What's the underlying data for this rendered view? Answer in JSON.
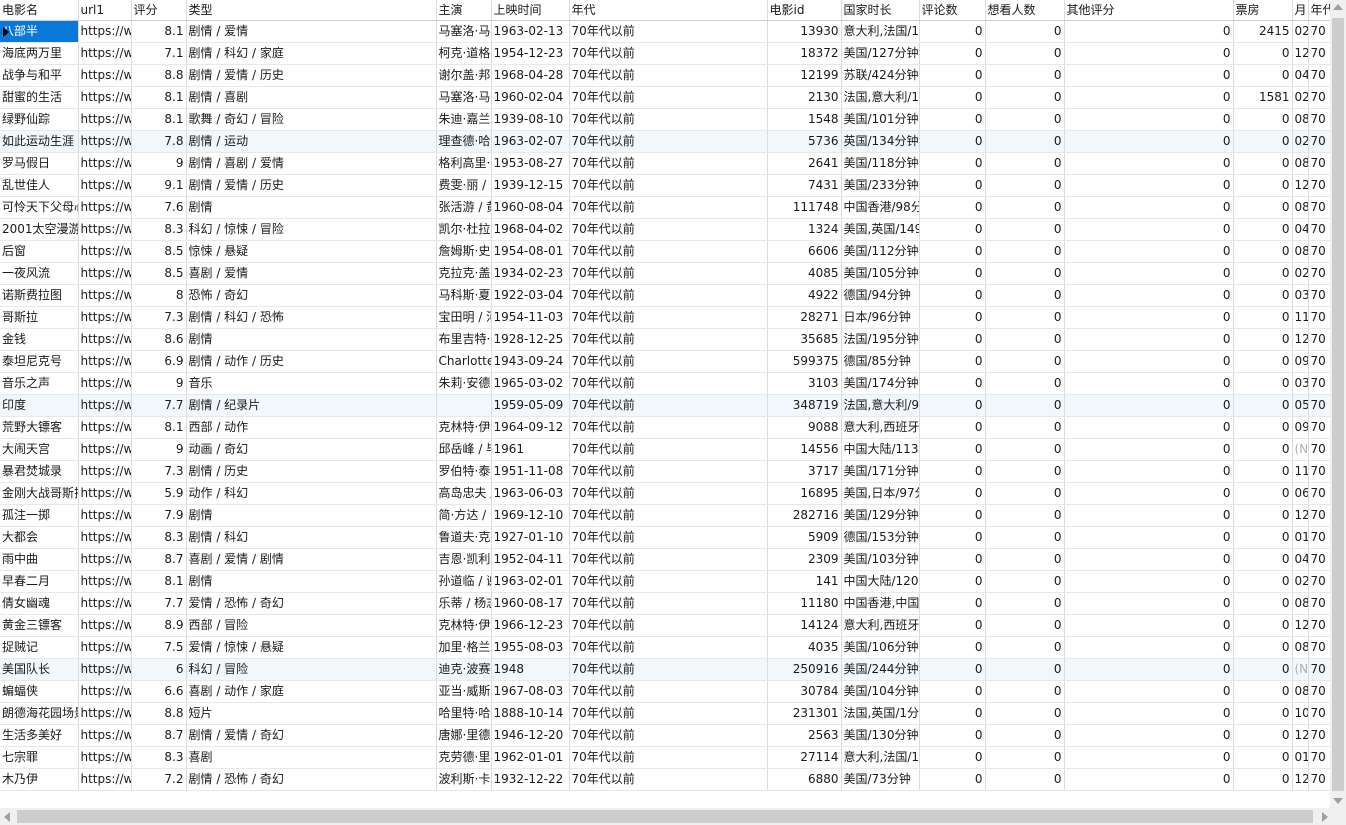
{
  "columns": [
    "电影名",
    "url1",
    "评分",
    "类型",
    "主演",
    "上映时间",
    "年代",
    "电影id",
    "国家时长",
    "评论数",
    "想看人数",
    "其他评分",
    "票房",
    "月",
    "年代"
  ],
  "rows": [
    [
      "八部半",
      "https://w",
      "8.1",
      "剧情 / 爱情",
      "马塞洛·马",
      "1963-02-13",
      "70年代以前",
      "13930",
      "意大利,法国/1",
      "0",
      "0",
      "0",
      "2415",
      "02",
      "70"
    ],
    [
      "海底两万里",
      "https://w",
      "7.1",
      "剧情 / 科幻 / 家庭",
      "柯克·道格",
      "1954-12-23",
      "70年代以前",
      "18372",
      "美国/127分钟",
      "0",
      "0",
      "0",
      "0",
      "12",
      "70"
    ],
    [
      "战争与和平",
      "https://w",
      "8.8",
      "剧情 / 爱情 / 历史",
      "谢尔盖·邦",
      "1968-04-28",
      "70年代以前",
      "12199",
      "苏联/424分钟",
      "0",
      "0",
      "0",
      "0",
      "04",
      "70"
    ],
    [
      "甜蜜的生活",
      "https://w",
      "8.1",
      "剧情 / 喜剧",
      "马塞洛·马",
      "1960-02-04",
      "70年代以前",
      "2130",
      "法国,意大利/1",
      "0",
      "0",
      "0",
      "1581",
      "02",
      "70"
    ],
    [
      "绿野仙踪",
      "https://w",
      "8.1",
      "歌舞 / 奇幻 / 冒险",
      "朱迪·嘉兰",
      "1939-08-10",
      "70年代以前",
      "1548",
      "美国/101分钟",
      "0",
      "0",
      "0",
      "0",
      "08",
      "70"
    ],
    [
      "如此运动生涯",
      "https://w",
      "7.8",
      "剧情 / 运动",
      "理查德·哈",
      "1963-02-07",
      "70年代以前",
      "5736",
      "英国/134分钟",
      "0",
      "0",
      "0",
      "0",
      "02",
      "70"
    ],
    [
      "罗马假日",
      "https://w",
      "9",
      "剧情 / 喜剧 / 爱情",
      "格利高里·",
      "1953-08-27",
      "70年代以前",
      "2641",
      "美国/118分钟",
      "0",
      "0",
      "0",
      "0",
      "08",
      "70"
    ],
    [
      "乱世佳人",
      "https://w",
      "9.1",
      "剧情 / 爱情 / 历史",
      "费雯·丽 /",
      "1939-12-15",
      "70年代以前",
      "7431",
      "美国/233分钟",
      "0",
      "0",
      "0",
      "0",
      "12",
      "70"
    ],
    [
      "可怜天下父母心",
      "https://w",
      "7.6",
      "剧情",
      "张活游 / 黄",
      "1960-08-04",
      "70年代以前",
      "111748",
      "中国香港/98分",
      "0",
      "0",
      "0",
      "0",
      "08",
      "70"
    ],
    [
      "2001太空漫游",
      "https://w",
      "8.3",
      "科幻 / 惊悚 / 冒险",
      "凯尔·杜拉",
      "1968-04-02",
      "70年代以前",
      "1324",
      "美国,英国/149",
      "0",
      "0",
      "0",
      "0",
      "04",
      "70"
    ],
    [
      "后窗",
      "https://w",
      "8.5",
      "惊悚 / 悬疑",
      "詹姆斯·史",
      "1954-08-01",
      "70年代以前",
      "6606",
      "美国/112分钟",
      "0",
      "0",
      "0",
      "0",
      "08",
      "70"
    ],
    [
      "一夜风流",
      "https://w",
      "8.5",
      "喜剧 / 爱情",
      "克拉克·盖",
      "1934-02-23",
      "70年代以前",
      "4085",
      "美国/105分钟",
      "0",
      "0",
      "0",
      "0",
      "02",
      "70"
    ],
    [
      "诺斯费拉图",
      "https://w",
      "8",
      "恐怖 / 奇幻",
      "马科斯·夏",
      "1922-03-04",
      "70年代以前",
      "4922",
      "德国/94分钟",
      "0",
      "0",
      "0",
      "0",
      "03",
      "70"
    ],
    [
      "哥斯拉",
      "https://w",
      "7.3",
      "剧情 / 科幻 / 恐怖",
      "宝田明 / 河",
      "1954-11-03",
      "70年代以前",
      "28271",
      "日本/96分钟",
      "0",
      "0",
      "0",
      "0",
      "11",
      "70"
    ],
    [
      "金钱",
      "https://w",
      "8.6",
      "剧情",
      "布里吉特·",
      "1928-12-25",
      "70年代以前",
      "35685",
      "法国/195分钟",
      "0",
      "0",
      "0",
      "0",
      "12",
      "70"
    ],
    [
      "泰坦尼克号",
      "https://w",
      "6.9",
      "剧情 / 动作 / 历史",
      "Charlotte",
      "1943-09-24",
      "70年代以前",
      "599375",
      "德国/85分钟",
      "0",
      "0",
      "0",
      "0",
      "09",
      "70"
    ],
    [
      "音乐之声",
      "https://w",
      "9",
      "音乐",
      "朱莉·安德",
      "1965-03-02",
      "70年代以前",
      "3103",
      "美国/174分钟",
      "0",
      "0",
      "0",
      "0",
      "03",
      "70"
    ],
    [
      "印度",
      "https://w",
      "7.7",
      "剧情 / 纪录片",
      "",
      "1959-05-09",
      "70年代以前",
      "348719",
      "法国,意大利/9",
      "0",
      "0",
      "0",
      "0",
      "05",
      "70"
    ],
    [
      "荒野大镖客",
      "https://w",
      "8.1",
      "西部 / 动作",
      "克林特·伊",
      "1964-09-12",
      "70年代以前",
      "9088",
      "意大利,西班牙,",
      "0",
      "0",
      "0",
      "0",
      "09",
      "70"
    ],
    [
      "大闹天宫",
      "https://w",
      "9",
      "动画 / 奇幻",
      "邱岳峰 / 毕",
      "1961",
      "70年代以前",
      "14556",
      "中国大陆/113",
      "0",
      "0",
      "0",
      "0",
      "(N",
      "70"
    ],
    [
      "暴君焚城录",
      "https://w",
      "7.3",
      "剧情 / 历史",
      "罗伯特·泰",
      "1951-11-08",
      "70年代以前",
      "3717",
      "美国/171分钟",
      "0",
      "0",
      "0",
      "0",
      "11",
      "70"
    ],
    [
      "金刚大战哥斯拉",
      "https://w",
      "5.9",
      "动作 / 科幻",
      "高岛忠夫 /",
      "1963-06-03",
      "70年代以前",
      "16895",
      "美国,日本/97分",
      "0",
      "0",
      "0",
      "0",
      "06",
      "70"
    ],
    [
      "孤注一掷",
      "https://w",
      "7.9",
      "剧情",
      "简·方达 /",
      "1969-12-10",
      "70年代以前",
      "282716",
      "美国/129分钟",
      "0",
      "0",
      "0",
      "0",
      "12",
      "70"
    ],
    [
      "大都会",
      "https://w",
      "8.3",
      "剧情 / 科幻",
      "鲁道夫·克",
      "1927-01-10",
      "70年代以前",
      "5909",
      "德国/153分钟",
      "0",
      "0",
      "0",
      "0",
      "01",
      "70"
    ],
    [
      "雨中曲",
      "https://w",
      "8.7",
      "喜剧 / 爱情 / 剧情",
      "吉恩·凯利",
      "1952-04-11",
      "70年代以前",
      "2309",
      "美国/103分钟",
      "0",
      "0",
      "0",
      "0",
      "04",
      "70"
    ],
    [
      "早春二月",
      "https://w",
      "8.1",
      "剧情",
      "孙道临 / 谢",
      "1963-02-01",
      "70年代以前",
      "141",
      "中国大陆/120分",
      "0",
      "0",
      "0",
      "0",
      "02",
      "70"
    ],
    [
      "倩女幽魂",
      "https://w",
      "7.7",
      "爱情 / 恐怖 / 奇幻",
      "乐蒂 / 杨志",
      "1960-08-17",
      "70年代以前",
      "11180",
      "中国香港,中国",
      "0",
      "0",
      "0",
      "0",
      "08",
      "70"
    ],
    [
      "黄金三镖客",
      "https://w",
      "8.9",
      "西部 / 冒险",
      "克林特·伊",
      "1966-12-23",
      "70年代以前",
      "14124",
      "意大利,西班牙,",
      "0",
      "0",
      "0",
      "0",
      "12",
      "70"
    ],
    [
      "捉贼记",
      "https://w",
      "7.5",
      "爱情 / 惊悚 / 悬疑",
      "加里·格兰",
      "1955-08-03",
      "70年代以前",
      "4035",
      "美国/106分钟",
      "0",
      "0",
      "0",
      "0",
      "08",
      "70"
    ],
    [
      "美国队长",
      "https://w",
      "6",
      "科幻 / 冒险",
      "迪克·波赛",
      "1948",
      "70年代以前",
      "250916",
      "美国/244分钟",
      "0",
      "0",
      "0",
      "0",
      "(N",
      "70"
    ],
    [
      "蝙蝠侠",
      "https://w",
      "6.6",
      "喜剧 / 动作 / 家庭",
      "亚当·威斯",
      "1967-08-03",
      "70年代以前",
      "30784",
      "美国/104分钟",
      "0",
      "0",
      "0",
      "0",
      "08",
      "70"
    ],
    [
      "朗德海花园场景",
      "https://w",
      "8.8",
      "短片",
      "哈里特·哈",
      "1888-10-14",
      "70年代以前",
      "231301",
      "法国,英国/1分",
      "0",
      "0",
      "0",
      "0",
      "10",
      "70"
    ],
    [
      "生活多美好",
      "https://w",
      "8.7",
      "剧情 / 爱情 / 奇幻",
      "唐娜·里德",
      "1946-12-20",
      "70年代以前",
      "2563",
      "美国/130分钟",
      "0",
      "0",
      "0",
      "0",
      "12",
      "70"
    ],
    [
      "七宗罪",
      "https://w",
      "8.3",
      "喜剧",
      "克劳德·里",
      "1962-01-01",
      "70年代以前",
      "27114",
      "意大利,法国/1",
      "0",
      "0",
      "0",
      "0",
      "01",
      "70"
    ],
    [
      "木乃伊",
      "https://w",
      "7.2",
      "剧情 / 恐怖 / 奇幻",
      "波利斯·卡",
      "1932-12-22",
      "70年代以前",
      "6880",
      "美国/73分钟",
      "0",
      "0",
      "0",
      "0",
      "12",
      "70"
    ]
  ]
}
